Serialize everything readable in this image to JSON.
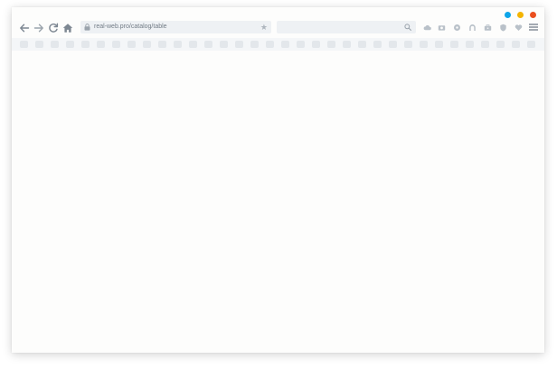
{
  "window": {
    "controls": [
      {
        "name": "window-control-blue",
        "color": "#0ea5e9"
      },
      {
        "name": "window-control-yellow",
        "color": "#f4b400"
      },
      {
        "name": "window-control-red",
        "color": "#ea4f1f"
      }
    ]
  },
  "toolbar": {
    "address": {
      "url": "real-web.pro/catalog/table",
      "icon": "lock-icon",
      "bookmark_icon": "star-icon"
    },
    "search": {
      "placeholder": "",
      "icon": "search-icon"
    },
    "nav_icons": [
      "back-arrow-icon",
      "forward-arrow-icon",
      "reload-icon",
      "home-icon"
    ],
    "extension_icons": [
      "cloud-icon",
      "camera-icon",
      "circle-icon",
      "user-icon",
      "briefcase-icon",
      "shield-icon",
      "heart-icon"
    ],
    "menu_icon": "hamburger-menu-icon"
  },
  "colors": {
    "icon": "#7d8792",
    "icon_muted": "#b9c1c9",
    "bar_background": "#eef1f4",
    "page_background": "#fdfdfc"
  }
}
